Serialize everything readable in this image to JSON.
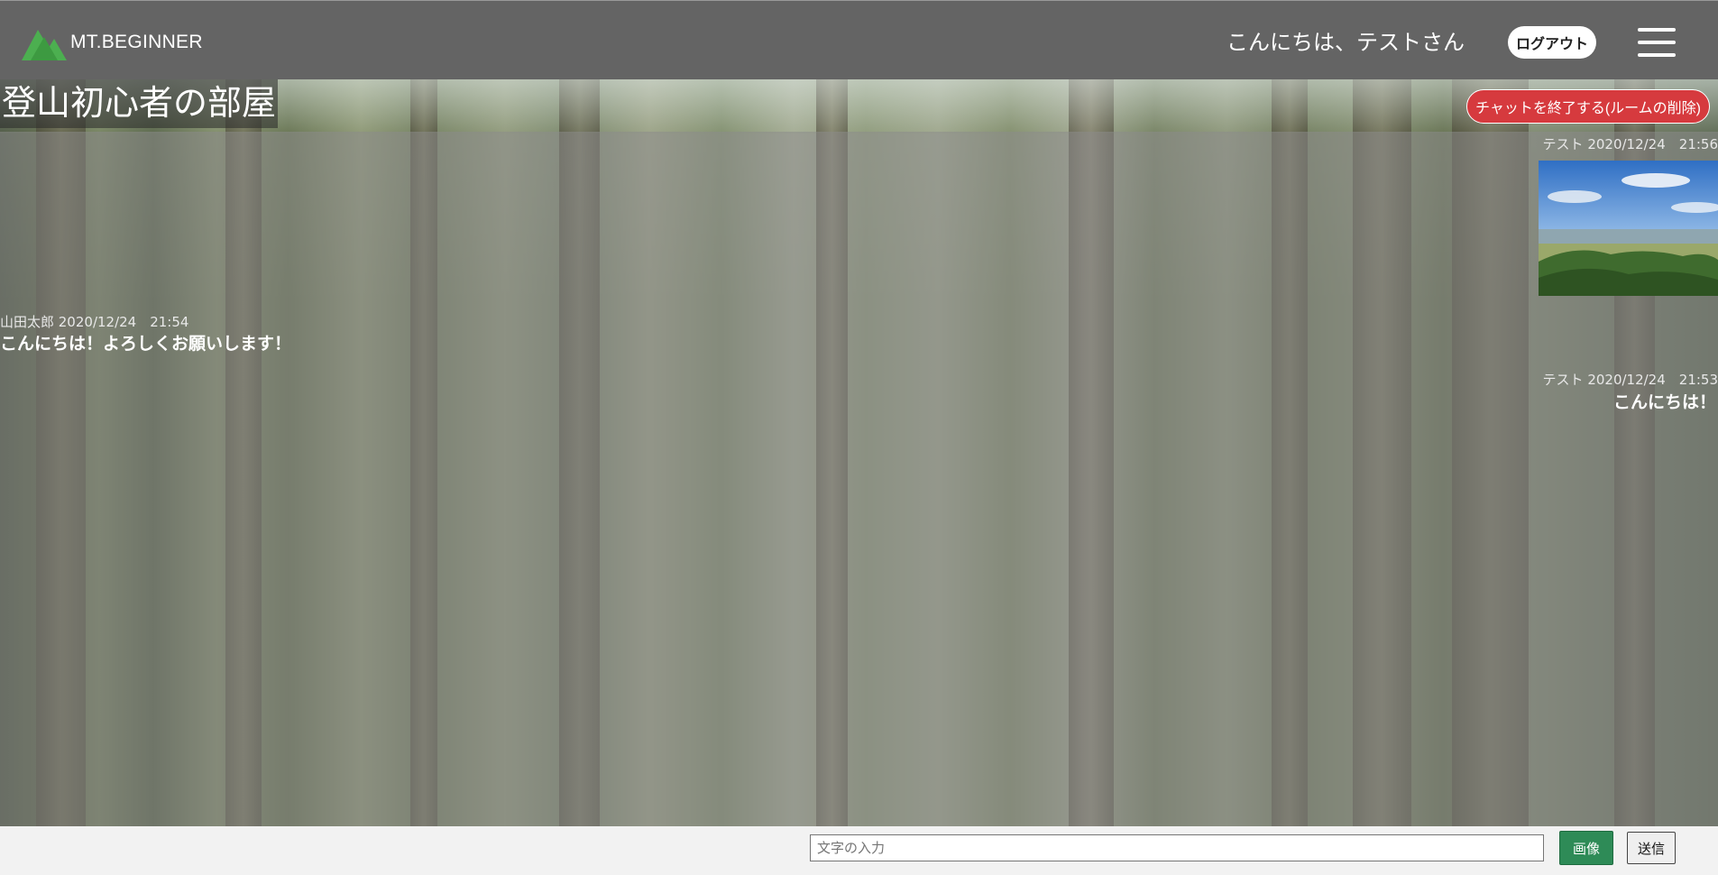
{
  "header": {
    "logo_text": "MT.BEGINNER",
    "greeting": "こんにちは、テストさん",
    "logout_label": "ログアウト",
    "menu_icon": "hamburger-menu-icon"
  },
  "room": {
    "title": "登山初心者の部屋",
    "end_button_label": "チャットを終了する(ルームの削除)"
  },
  "messages": [
    {
      "author": "テスト",
      "timestamp": "2020/12/24　21:56",
      "meta": "テスト 2020/12/24　21:56",
      "type": "image",
      "side": "right"
    },
    {
      "author": "山田太郎",
      "timestamp": "2020/12/24　21:54",
      "meta": "山田太郎 2020/12/24　21:54",
      "text": "こんにちは！よろしくお願いします！",
      "side": "left"
    },
    {
      "author": "テスト",
      "timestamp": "2020/12/24　21:53",
      "meta": "テスト 2020/12/24　21:53",
      "text": "こんにちは！",
      "side": "right"
    }
  ],
  "composer": {
    "placeholder": "文字の入力",
    "value": "",
    "image_button_label": "画像",
    "send_button_label": "送信"
  },
  "colors": {
    "header_bg": "#646464",
    "end_button_bg": "#d63a3e",
    "image_button_bg": "#2e8b57",
    "logo_green": "#4caf50"
  }
}
